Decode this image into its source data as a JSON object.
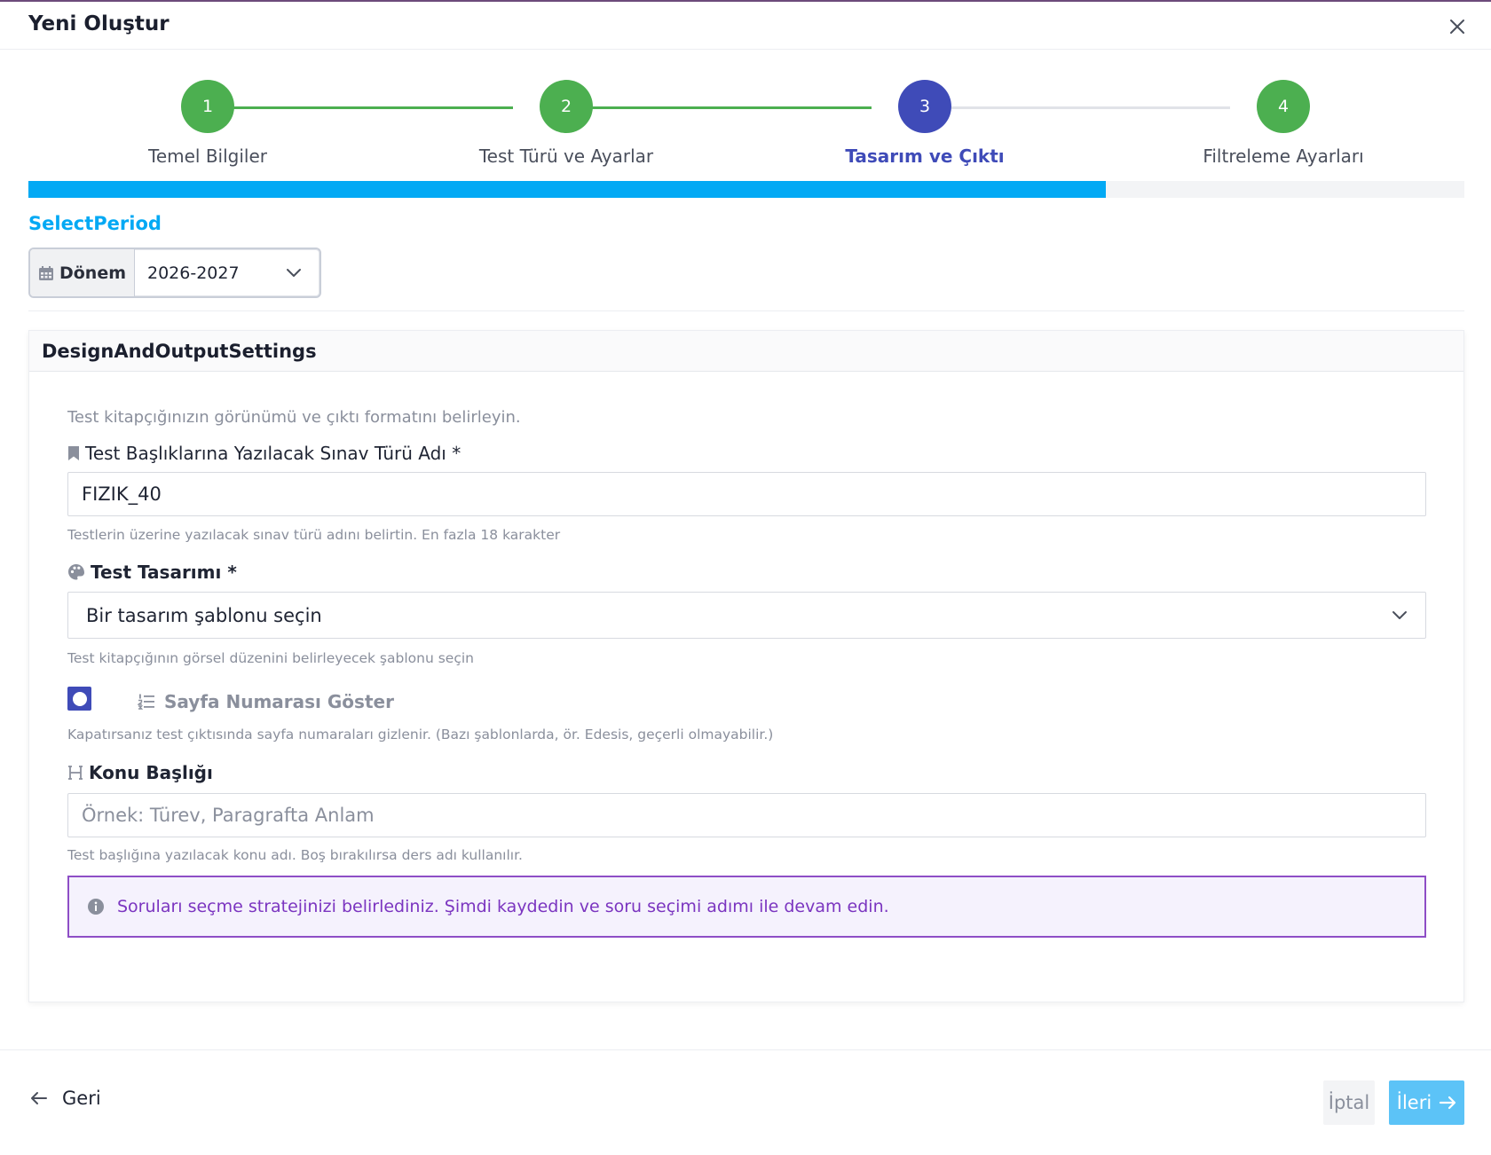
{
  "header": {
    "title": "Yeni Oluştur",
    "close_icon": "close-icon"
  },
  "stepper": {
    "steps": [
      {
        "number": "1",
        "label": "Temel Bilgiler",
        "state": "done"
      },
      {
        "number": "2",
        "label": "Test Türü ve Ayarlar",
        "state": "done"
      },
      {
        "number": "3",
        "label": "Tasarım ve Çıktı",
        "state": "active"
      },
      {
        "number": "4",
        "label": "Filtreleme Ayarları",
        "state": "done"
      }
    ],
    "progress_fraction": 0.75,
    "colors": {
      "done": "#4caf50",
      "active": "#3f4bb8",
      "progress": "#03a9f4"
    }
  },
  "period": {
    "section_title": "SelectPeriod",
    "addon_label": "Dönem",
    "value": "2026-2027"
  },
  "design": {
    "card_title": "DesignAndOutputSettings",
    "intro": "Test kitapçığınızın görünümü ve çıktı formatını belirleyin.",
    "exam_name": {
      "label": "Test Başlıklarına Yazılacak Sınav Türü Adı *",
      "value": "FIZIK_40",
      "help": "Testlerin üzerine yazılacak sınav türü adını belirtin. En fazla 18 karakter"
    },
    "template": {
      "label": "Test Tasarımı *",
      "value": "Bir tasarım şablonu seçin",
      "help": "Test kitapçığının görsel düzenini belirleyecek şablonu seçin"
    },
    "page_numbers": {
      "label": "Sayfa Numarası Göster",
      "help": "Kapatırsanız test çıktısında sayfa numaraları gizlenir. (Bazı şablonlarda, ör. Edesis, geçerli olmayabilir.)"
    },
    "topic": {
      "label": "Konu Başlığı",
      "placeholder": "Örnek: Türev, Paragrafta Anlam",
      "help": "Test başlığına yazılacak konu adı. Boş bırakılırsa ders adı kullanılır."
    },
    "alert": "Soruları seçme stratejinizi belirlediniz. Şimdi kaydedin ve soru seçimi adımı ile devam edin."
  },
  "footer": {
    "back_label": "Geri",
    "cancel_label": "İptal",
    "next_label": "İleri"
  }
}
